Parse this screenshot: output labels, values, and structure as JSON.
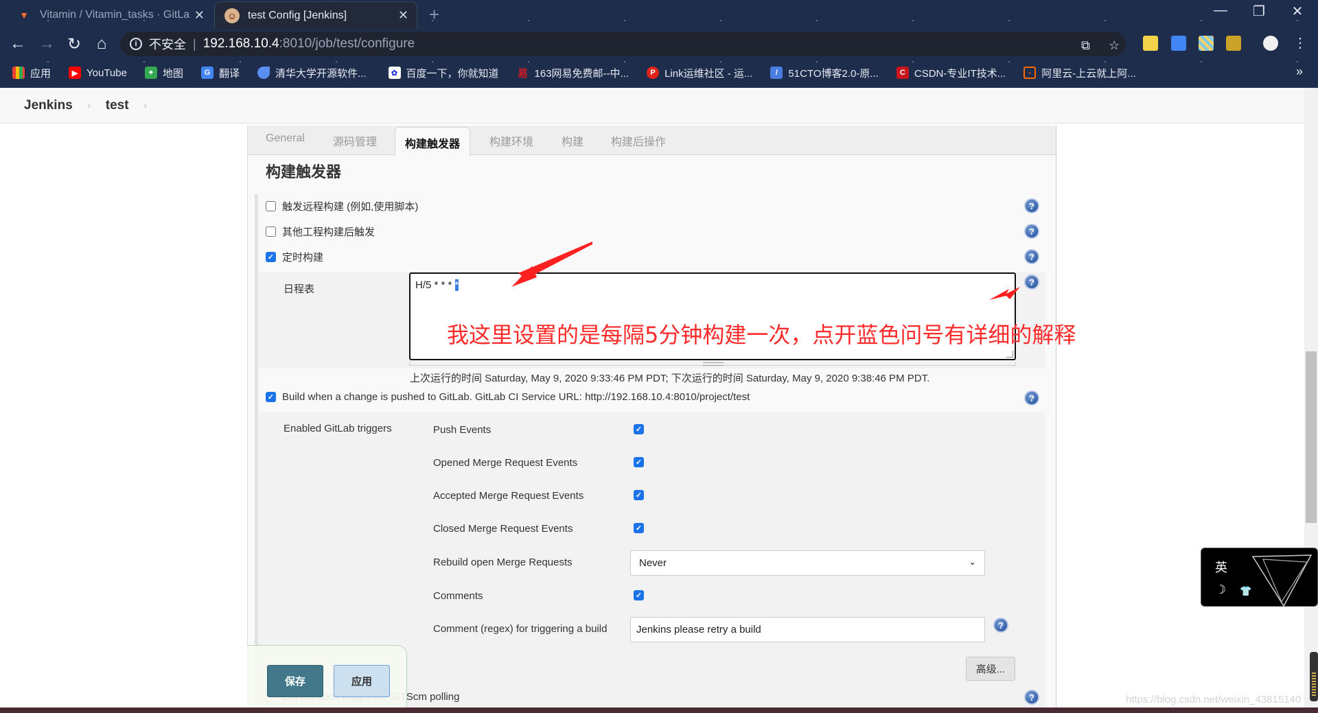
{
  "browser": {
    "tabs": [
      {
        "title": "Vitamin / Vitamin_tasks · GitLa",
        "icon": "gitlab-icon",
        "active": false
      },
      {
        "title": "test Config [Jenkins]",
        "icon": "jenkins-icon",
        "active": true
      }
    ],
    "new_tab_label": "+",
    "window_controls": {
      "minimize": "—",
      "restore": "❐",
      "close": "✕"
    },
    "nav": {
      "back": "←",
      "forward": "→",
      "reload": "↻",
      "home": "⌂"
    },
    "address": {
      "security_label": "不安全",
      "host": "192.168.10.4",
      "path": ":8010/job/test/configure"
    },
    "bookmarks": [
      {
        "label": "应用",
        "icon": "apps-grid-icon",
        "color": "#e94235"
      },
      {
        "label": "YouTube",
        "icon": "youtube-icon",
        "color": "#ff0000"
      },
      {
        "label": "地图",
        "icon": "maps-icon",
        "color": "#34a853"
      },
      {
        "label": "翻译",
        "icon": "translate-icon",
        "color": "#4285f4"
      },
      {
        "label": "清华大学开源软件...",
        "icon": "tuna-icon",
        "color": "#5a8df0"
      },
      {
        "label": "百度一下，你就知道",
        "icon": "baidu-icon",
        "color": "#2932e1"
      },
      {
        "label": "163网易免费邮--中...",
        "icon": "netease-icon",
        "color": "#d71921"
      },
      {
        "label": "Link运维社区 - 运...",
        "icon": "link-p-icon",
        "color": "#e2231a"
      },
      {
        "label": "51CTO博客2.0-原...",
        "icon": "51cto-icon",
        "color": "#4a7de0"
      },
      {
        "label": "CSDN-专业IT技术...",
        "icon": "csdn-icon",
        "color": "#c9151e"
      },
      {
        "label": "阿里云-上云就上阿...",
        "icon": "aliyun-icon",
        "color": "#ff6a00"
      }
    ],
    "bookmarks_more": "»"
  },
  "breadcrumb": {
    "items": [
      "Jenkins",
      "test"
    ],
    "separator": "›"
  },
  "config": {
    "tabs": [
      "General",
      "源码管理",
      "构建触发器",
      "构建环境",
      "构建",
      "构建后操作"
    ],
    "active_tab": "构建触发器",
    "section_title": "构建触发器",
    "triggers": [
      {
        "label": "触发远程构建 (例如,使用脚本)",
        "checked": false
      },
      {
        "label": "其他工程构建后触发",
        "checked": false
      },
      {
        "label": "定时构建",
        "checked": true
      }
    ],
    "schedule": {
      "label": "日程表",
      "value_prefix": "H/5 * * * ",
      "value_selected": "*",
      "next_run": "上次运行的时间 Saturday, May 9, 2020 9:33:46 PM PDT; 下次运行的时间 Saturday, May 9, 2020 9:38:46 PM PDT."
    },
    "gitlab": {
      "label": "Build when a change is pushed to GitLab. GitLab CI Service URL: http://192.168.10.4:8010/project/test",
      "checked": true,
      "heading": "Enabled GitLab triggers",
      "events": [
        {
          "label": "Push Events",
          "checked": true
        },
        {
          "label": "Opened Merge Request Events",
          "checked": true
        },
        {
          "label": "Accepted Merge Request Events",
          "checked": true
        },
        {
          "label": "Closed Merge Request Events",
          "checked": true
        }
      ],
      "rebuild_label": "Rebuild open Merge Requests",
      "rebuild_value": "Never",
      "comments_label": "Comments",
      "comments_checked": true,
      "comment_regex_label": "Comment (regex) for triggering a build",
      "comment_regex_value": "Jenkins please retry a build",
      "advanced_label": "高级..."
    },
    "github_label": "GitHub hook trigger for GITScm polling",
    "save_label": "保存",
    "apply_label": "应用",
    "help_glyph": "?"
  },
  "annotation": {
    "text": "我这里设置的是每隔5分钟构建一次，点开蓝色问号有详细的解释",
    "color": "#ff2a2a"
  },
  "ime_widget": {
    "lang": "英",
    "moon": "☽",
    "shirt": "👕"
  },
  "watermark": "https://blog.csdn.net/weixin_43815140"
}
